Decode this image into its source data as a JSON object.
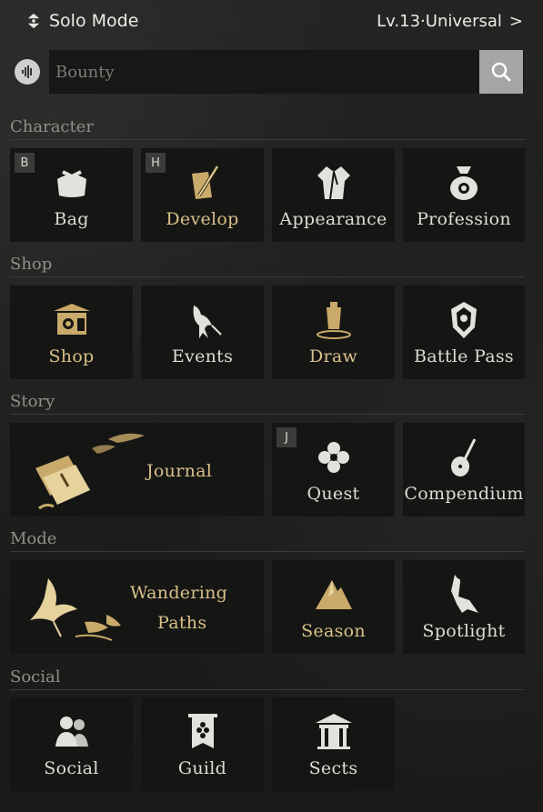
{
  "header": {
    "mode_label": "Solo Mode",
    "level_label": "Lv.13·Universal",
    "chevron": ">"
  },
  "search": {
    "placeholder": "Bounty"
  },
  "sections": {
    "character": "Character",
    "shop": "Shop",
    "story": "Story",
    "mode": "Mode",
    "social": "Social"
  },
  "tiles": {
    "bag": {
      "label": "Bag",
      "hotkey": "B"
    },
    "develop": {
      "label": "Develop",
      "hotkey": "H"
    },
    "appearance": {
      "label": "Appearance"
    },
    "profession": {
      "label": "Profession"
    },
    "shop": {
      "label": "Shop"
    },
    "events": {
      "label": "Events"
    },
    "draw": {
      "label": "Draw"
    },
    "battle_pass": {
      "label": "Battle Pass"
    },
    "journal": {
      "label": "Journal"
    },
    "quest": {
      "label": "Quest",
      "hotkey": "J"
    },
    "compendium": {
      "label": "Compendium"
    },
    "wandering_paths": {
      "label_line1": "Wandering",
      "label_line2": "Paths"
    },
    "season": {
      "label": "Season"
    },
    "spotlight": {
      "label": "Spotlight"
    },
    "social": {
      "label": "Social"
    },
    "guild": {
      "label": "Guild"
    },
    "sects": {
      "label": "Sects"
    }
  },
  "colors": {
    "accent_gold": "#d9c08a",
    "text_white": "#dcdcd6",
    "tile_bg": "#151614",
    "section_label": "#8f8f8a"
  }
}
